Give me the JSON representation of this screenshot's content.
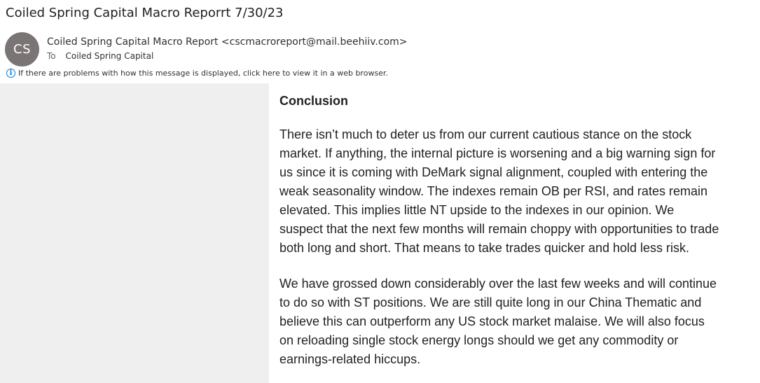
{
  "email": {
    "subject": "Coiled Spring Capital Macro Reporrt 7/30/23",
    "avatar_initials": "CS",
    "avatar_color": "#7a7574",
    "sender": "Coiled Spring Capital Macro Report <cscmacroreport@mail.beehiiv.com>",
    "to_label": "To",
    "to_recipient": "Coiled Spring Capital",
    "info_icon": "info-circle-icon",
    "info_message": "If there are problems with how this message is displayed, click here to view it in a web browser."
  },
  "body": {
    "heading": "Conclusion",
    "paragraphs": [
      "There isn’t much to deter us from our current cautious stance on the stock market. If anything, the internal picture is worsening and a big warning sign for us since it is coming with DeMark signal alignment, coupled with entering the weak seasonality window. The indexes remain OB per RSI, and rates remain elevated. This implies little NT upside to the indexes in our opinion. We suspect that the next few months will remain choppy with opportunities to trade both long and short. That means to take trades quicker and hold less risk.",
      "We have grossed down considerably over the last few weeks and will continue to do so with ST positions. We are still quite long in our China Thematic and believe this can outperform any US stock market malaise. We will also focus on reloading single stock energy longs should we get any commodity or earnings-related hiccups."
    ]
  }
}
